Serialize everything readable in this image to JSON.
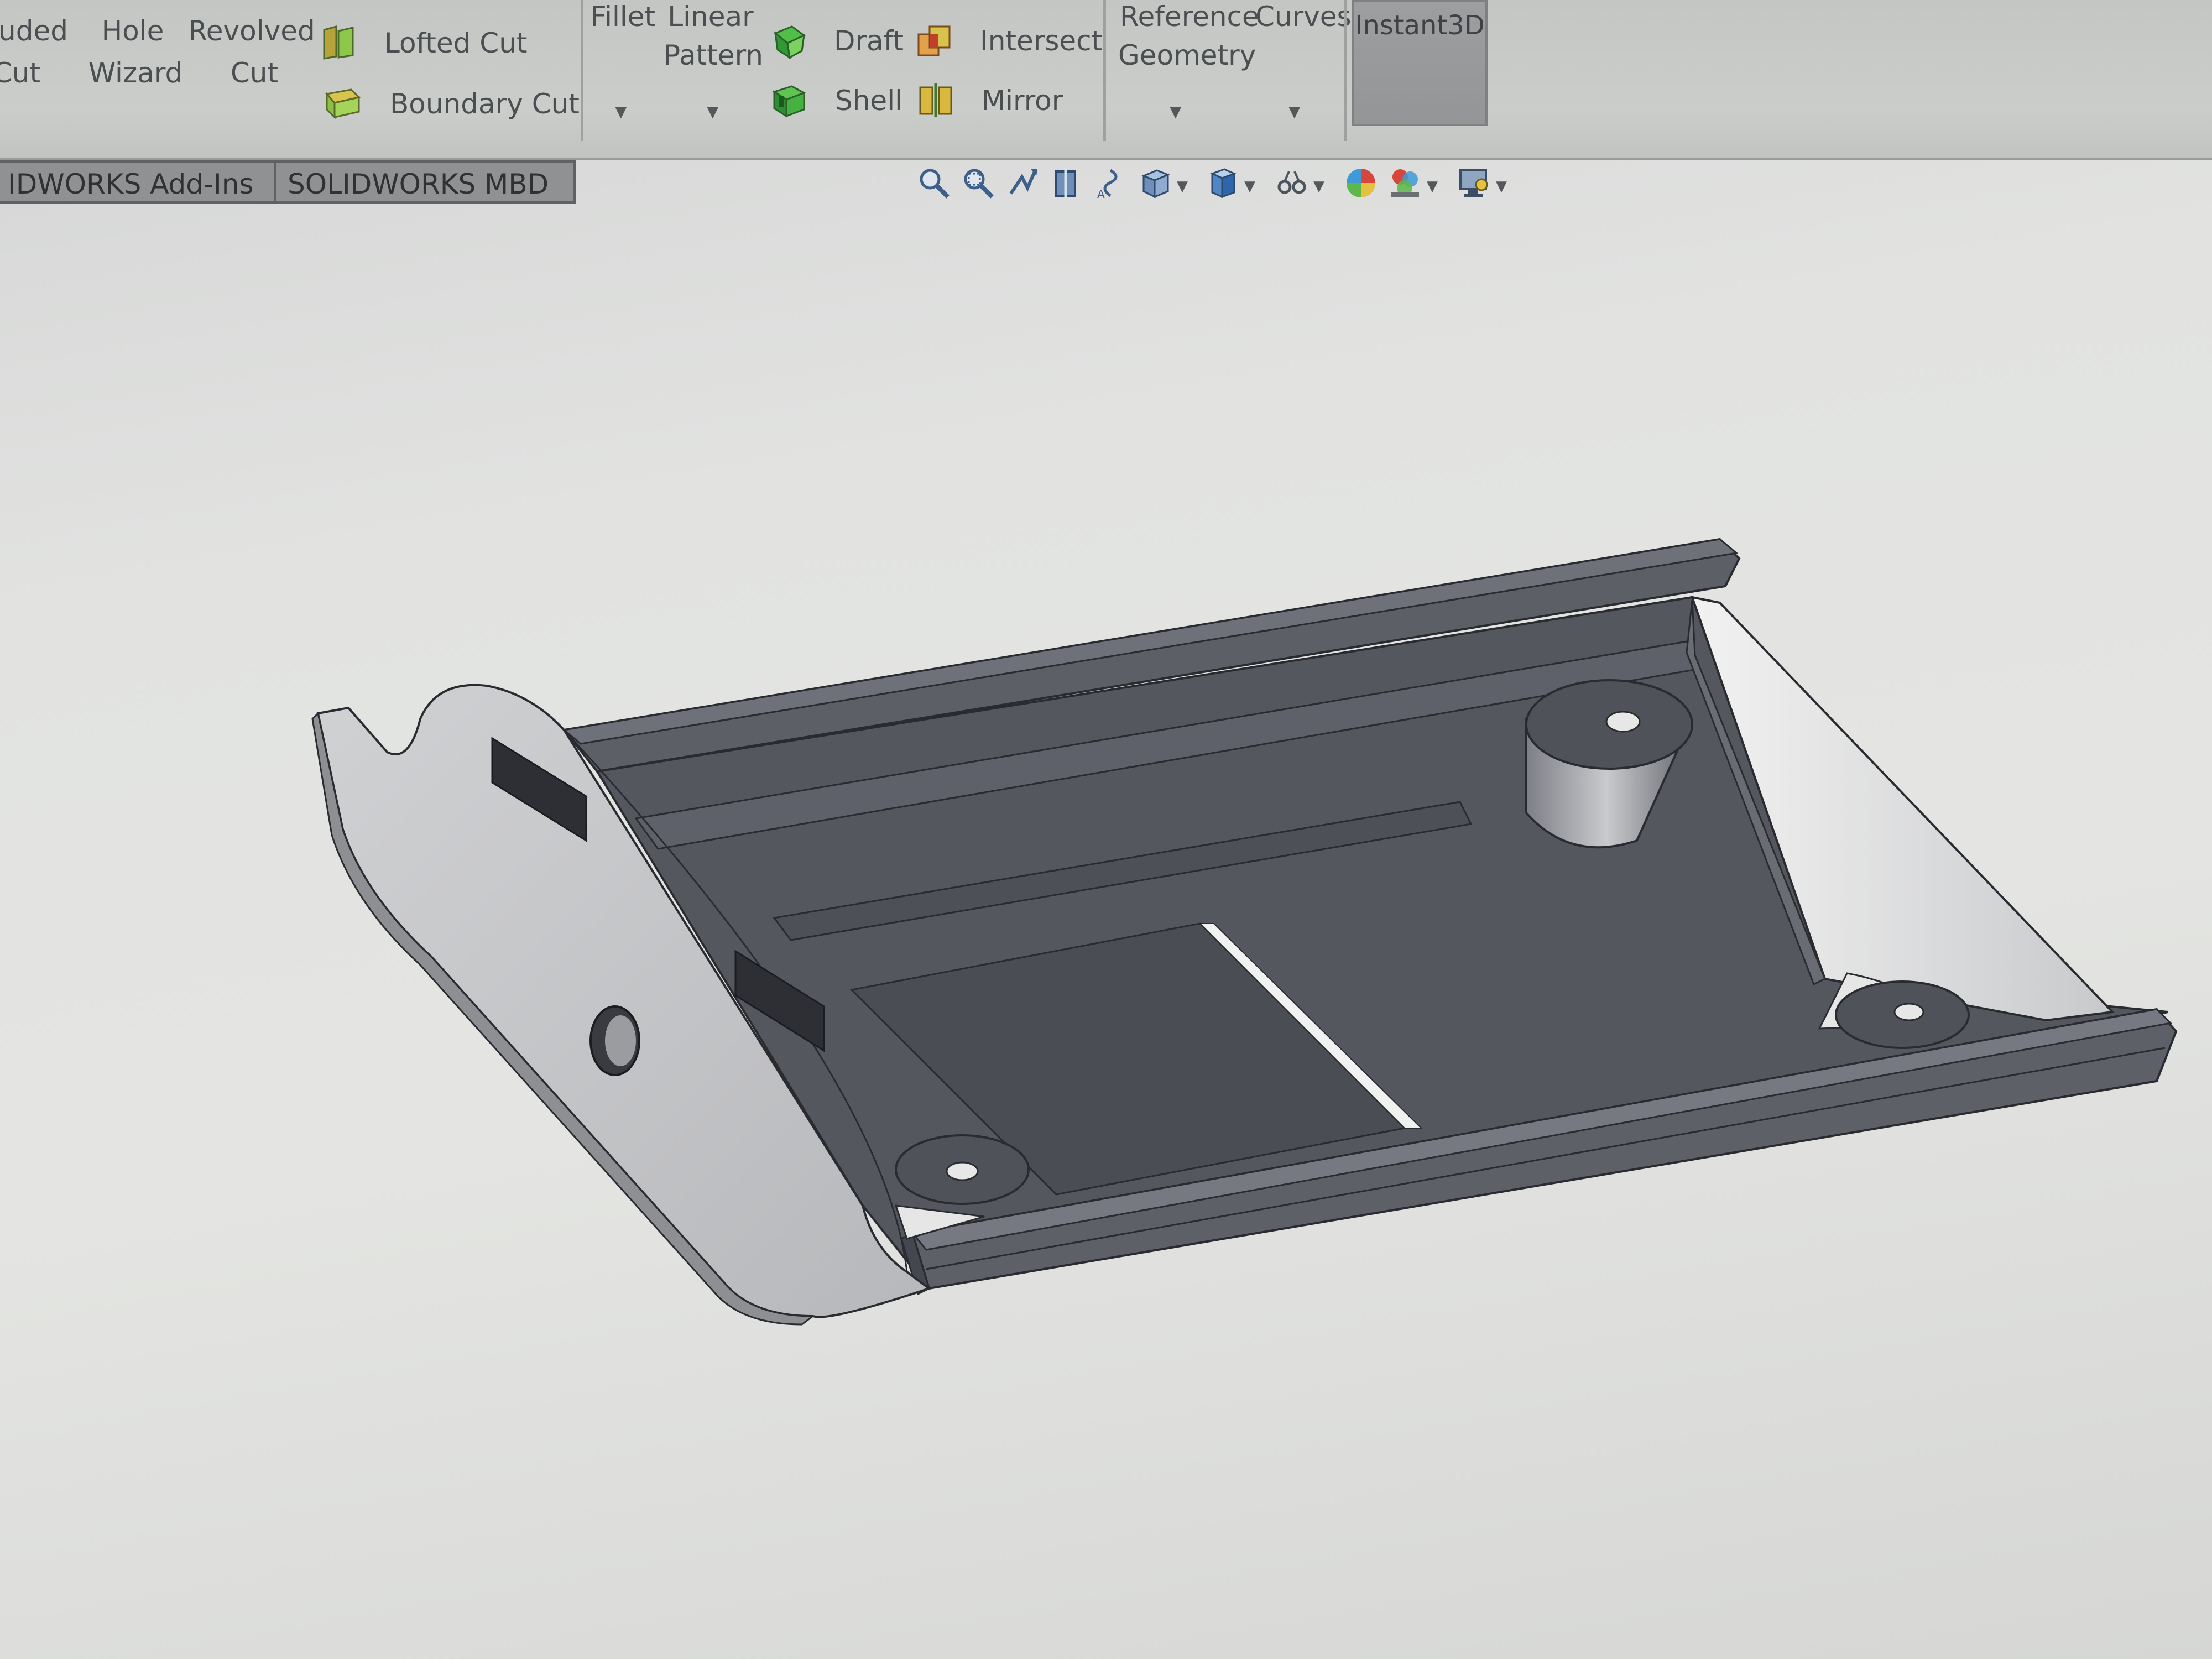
{
  "ribbon": {
    "extruded_cut": {
      "line1": "uded",
      "line2": "Cut"
    },
    "hole_wizard": {
      "line1": "Hole",
      "line2": "Wizard"
    },
    "revolved_cut": {
      "line1": "Revolved",
      "line2": "Cut"
    },
    "lofted_cut": "Lofted Cut",
    "boundary_cut": "Boundary Cut",
    "fillet": "Fillet",
    "linear_pattern": {
      "line1": "Linear",
      "line2": "Pattern"
    },
    "draft": "Draft",
    "intersect": "Intersect",
    "shell": "Shell",
    "mirror": "Mirror",
    "reference_geometry": {
      "line1": "Reference",
      "line2": "Geometry"
    },
    "curves": "Curves",
    "instant3d": "Instant3D"
  },
  "tabs": [
    {
      "label": "IDWORKS Add-Ins"
    },
    {
      "label": "SOLIDWORKS MBD"
    }
  ],
  "hud_icons": [
    "zoom-to-fit-icon",
    "zoom-to-area-icon",
    "previous-view-icon",
    "section-view-icon",
    "dynamic-annotation-icon",
    "view-orientation-icon",
    "display-style-icon",
    "hide-show-items-icon",
    "edit-appearance-icon",
    "apply-scene-icon",
    "view-settings-icon"
  ],
  "colors": {
    "model_body": "#55575f",
    "model_face_light": "#c9cacc",
    "background": "#e2e3e1",
    "ribbon": "#c8cac7"
  }
}
